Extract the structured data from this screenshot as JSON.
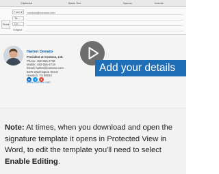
{
  "ribbon": {
    "items": [
      "Clipboard",
      "Basic Text",
      "Names",
      "Include"
    ]
  },
  "compose": {
    "from_label": "From ▾",
    "from_address": "contoso@contoso.com",
    "to_label": "To...",
    "cc_label": "Cc...",
    "send_label": "Send",
    "subject_label": "Subject"
  },
  "signature": {
    "name": "Harlen Donato",
    "role": "President at Contoso, Ltd.",
    "phone": "Phone: 482-555-2738",
    "mobile": "Mobile: 482-555-4718",
    "email": "Email: harlen@contoso.com",
    "street": "5678 Washington Street",
    "city": "Houston, TX 98010",
    "website": "www.contoso.com",
    "social": [
      "in",
      "t",
      "f"
    ]
  },
  "video": {
    "play_icon": "play-icon",
    "cta": "Add your details"
  },
  "note": {
    "lead": "Note:",
    "text": " At times, when you download and open the signature template it opens in Protected View in Word, to edit the template you'll need to select ",
    "action": "Enable Editing",
    "end": "."
  },
  "colors": {
    "accent": "#1e6fb8",
    "name": "#0f5fa0",
    "note_bg": "#f2f2f2"
  }
}
